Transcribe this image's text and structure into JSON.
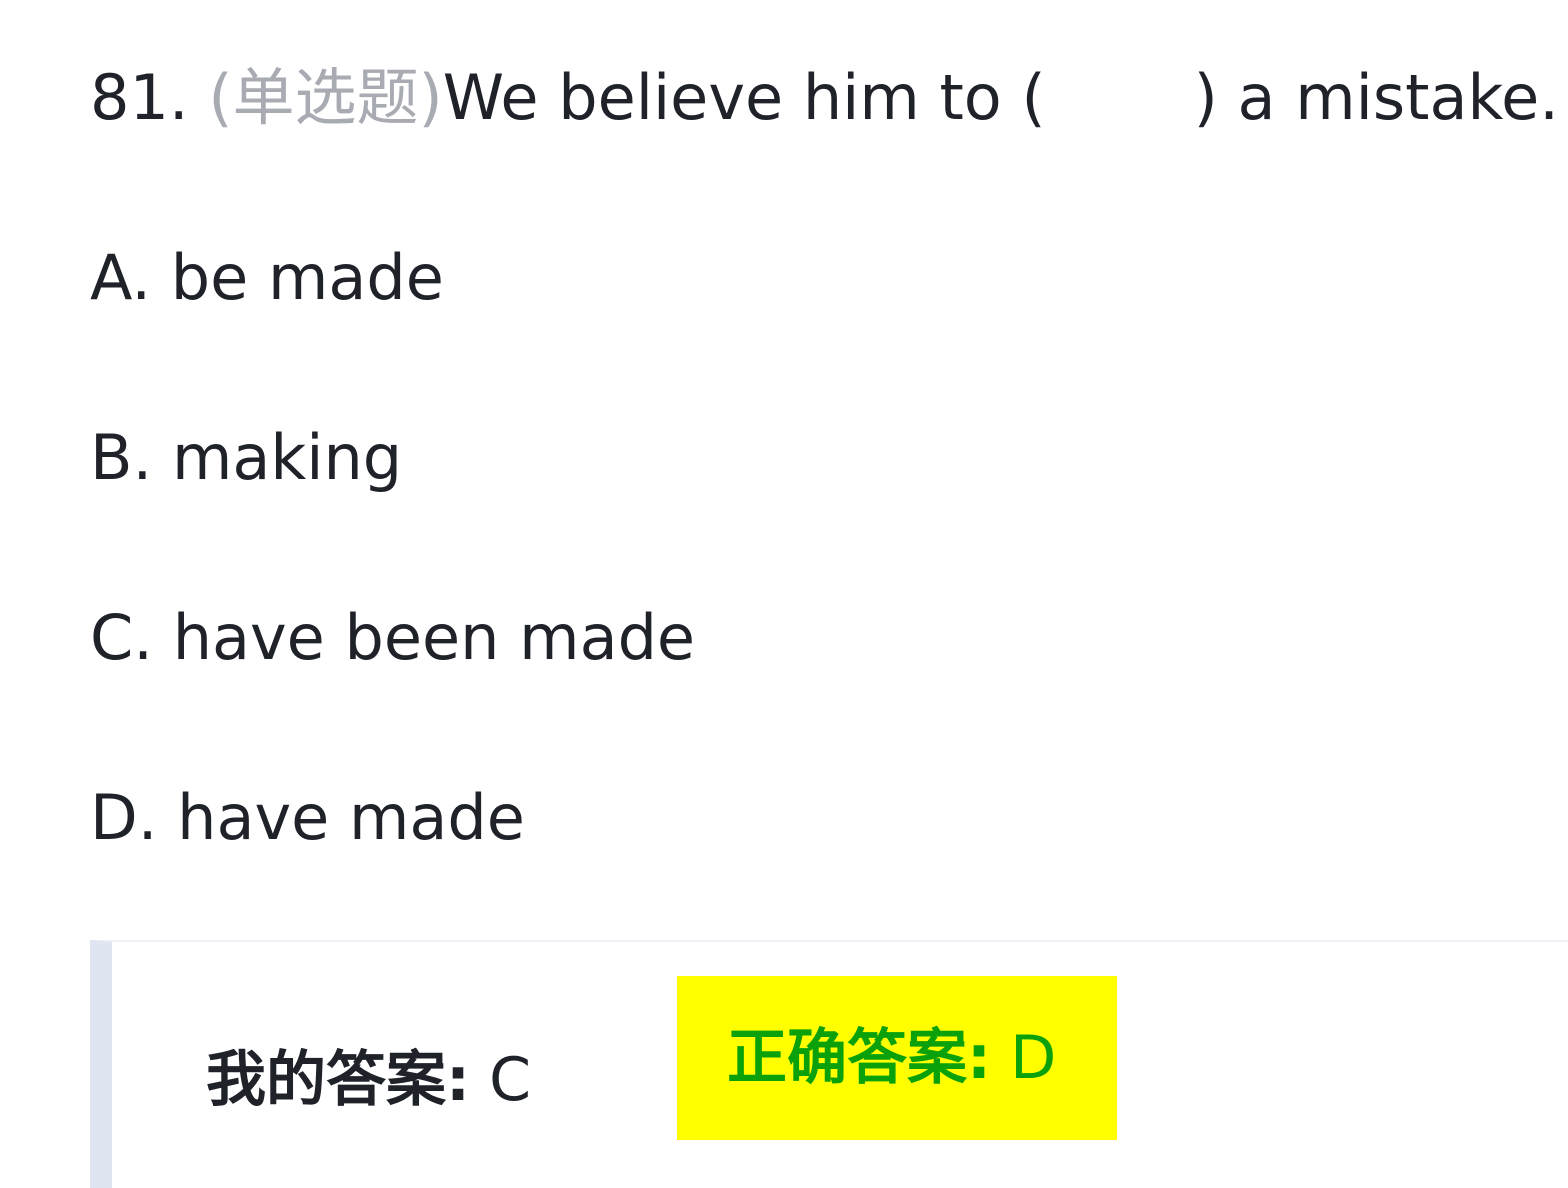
{
  "question": {
    "number": "81. ",
    "type_label": "(单选题)",
    "text_before": "We believe him to (",
    "text_after": ") a mistake."
  },
  "options": [
    {
      "label": "A. be made"
    },
    {
      "label": "B. making"
    },
    {
      "label": "C. have been made"
    },
    {
      "label": "D. have made"
    }
  ],
  "answers": {
    "my_answer_label": "我的答案:",
    "my_answer_value": " C",
    "correct_answer_label": "正确答案:",
    "correct_answer_value": " D",
    "highlight_color": "#ffff00",
    "correct_color": "#0aa10a"
  }
}
